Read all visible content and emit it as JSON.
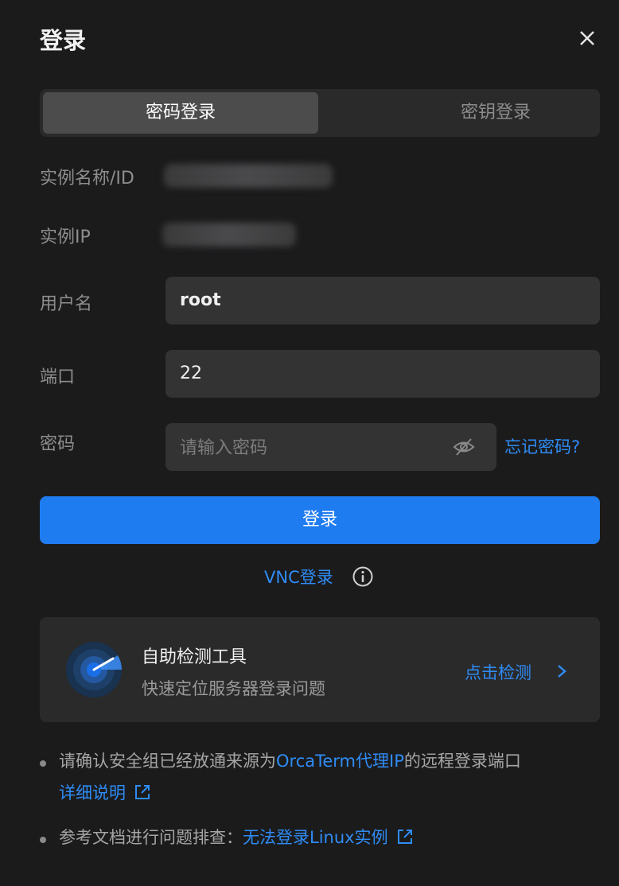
{
  "dialog": {
    "title": "登录",
    "close_icon": "close-icon"
  },
  "tabs": [
    {
      "label": "密码登录",
      "active": true
    },
    {
      "label": "密钥登录",
      "active": false
    }
  ],
  "form": {
    "instance_name_label": "实例名称/ID",
    "instance_ip_label": "实例IP",
    "username_label": "用户名",
    "username_value": "root",
    "port_label": "端口",
    "port_value": "22",
    "password_label": "密码",
    "password_placeholder": "请输入密码",
    "password_visibility_icon": "eye-off-icon",
    "forgot_password": "忘记密码?"
  },
  "login_button": "登录",
  "vnc": {
    "label": "VNC登录",
    "icon": "info-icon"
  },
  "self_check": {
    "title": "自助检测工具",
    "subtitle": "快速定位服务器登录问题",
    "action": "点击检测",
    "icon": "radar-icon"
  },
  "notes": {
    "note1_prefix": "请确认安全组已经放通来源为",
    "note1_link": "OrcaTerm代理IP",
    "note1_suffix": "的远程登录端口",
    "note1_detail_link": "详细说明",
    "note2_prefix": "参考文档进行问题排查：",
    "note2_link": "无法登录Linux实例"
  },
  "colors": {
    "background": "#1b1b1c",
    "accent": "#1f7cf0",
    "link": "#2f8cf5"
  }
}
